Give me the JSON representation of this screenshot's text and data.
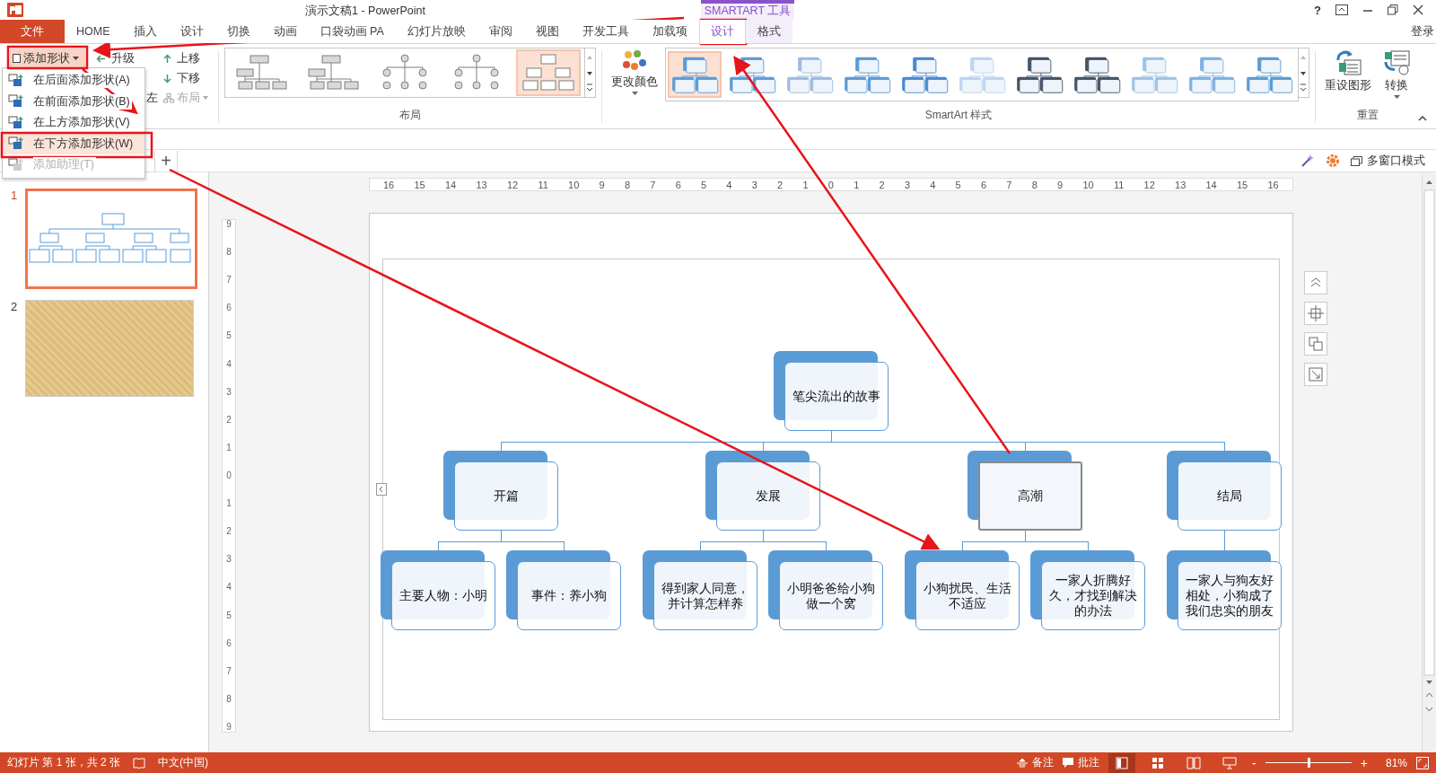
{
  "window": {
    "title": "演示文稿1 - PowerPoint",
    "context_header": "SMARTART 工具",
    "help": "?",
    "sign_in": "登录"
  },
  "tabs": [
    {
      "label": "文件",
      "kind": "file",
      "selected": false
    },
    {
      "label": "HOME",
      "kind": "normal",
      "selected": false
    },
    {
      "label": "插入",
      "kind": "normal",
      "selected": false
    },
    {
      "label": "设计",
      "kind": "normal",
      "selected": false
    },
    {
      "label": "切换",
      "kind": "normal",
      "selected": false
    },
    {
      "label": "动画",
      "kind": "normal",
      "selected": false
    },
    {
      "label": "口袋动画 PA",
      "kind": "normal",
      "selected": false
    },
    {
      "label": "幻灯片放映",
      "kind": "normal",
      "selected": false
    },
    {
      "label": "审阅",
      "kind": "normal",
      "selected": false
    },
    {
      "label": "视图",
      "kind": "normal",
      "selected": false
    },
    {
      "label": "开发工具",
      "kind": "normal",
      "selected": false
    },
    {
      "label": "加载项",
      "kind": "normal",
      "selected": false
    },
    {
      "label": "设计",
      "kind": "context",
      "selected": true
    },
    {
      "label": "格式",
      "kind": "context",
      "selected": false
    }
  ],
  "ribbon": {
    "create": {
      "add_shape": "添加形状",
      "promote": "升级",
      "move_up": "上移",
      "move_down": "下移",
      "right_to_left": "左",
      "layout": "布局"
    },
    "layouts": {
      "label": "布局",
      "items": [
        {
          "selected": false
        },
        {
          "selected": false
        },
        {
          "selected": false
        },
        {
          "selected": false
        },
        {
          "selected": true
        }
      ]
    },
    "change_colors": "更改颜色",
    "styles": {
      "label": "SmartArt 样式",
      "items": [
        {
          "selected": true
        },
        {
          "selected": false
        },
        {
          "selected": false
        },
        {
          "selected": false
        },
        {
          "selected": false
        },
        {
          "selected": false
        },
        {
          "selected": false
        },
        {
          "selected": false
        },
        {
          "selected": false
        },
        {
          "selected": false
        },
        {
          "selected": false
        }
      ]
    },
    "reset": {
      "label": "重置",
      "reset_graphic": "重设图形",
      "convert": "转换"
    }
  },
  "add_shape_menu": [
    {
      "label": "在后面添加形状(A)",
      "selected": false,
      "disabled": false
    },
    {
      "label": "在前面添加形状(B)",
      "selected": false,
      "disabled": false
    },
    {
      "label": "在上方添加形状(V)",
      "selected": false,
      "disabled": false
    },
    {
      "label": "在下方添加形状(W)",
      "selected": true,
      "disabled": false
    },
    {
      "label": "添加助理(T)",
      "selected": false,
      "disabled": true
    }
  ],
  "doc_bar": {
    "new_tab": "+",
    "multi_window": "多窗口模式"
  },
  "slides": [
    {
      "number": "1",
      "selected": true,
      "kind": "org-chart"
    },
    {
      "number": "2",
      "selected": false,
      "kind": "texture"
    }
  ],
  "ruler": {
    "horizontal": [
      "16",
      "15",
      "14",
      "13",
      "12",
      "11",
      "10",
      "9",
      "8",
      "7",
      "6",
      "5",
      "4",
      "3",
      "2",
      "1",
      "0",
      "1",
      "2",
      "3",
      "4",
      "5",
      "6",
      "7",
      "8",
      "9",
      "10",
      "11",
      "12",
      "13",
      "14",
      "15",
      "16"
    ],
    "vertical": [
      "9",
      "8",
      "7",
      "6",
      "5",
      "4",
      "3",
      "2",
      "1",
      "0",
      "1",
      "2",
      "3",
      "4",
      "5",
      "6",
      "7",
      "8",
      "9"
    ]
  },
  "smartart": {
    "root": "笔尖流出的故事",
    "children": [
      {
        "text": "开篇",
        "selected": false,
        "children": [
          {
            "text": "主要人物：小明",
            "selected": false
          },
          {
            "text": "事件：养小狗",
            "selected": false
          }
        ]
      },
      {
        "text": "发展",
        "selected": false,
        "children": [
          {
            "text": "得到家人同意，并计算怎样养",
            "selected": false
          },
          {
            "text": "小明爸爸给小狗做一个窝",
            "selected": false
          }
        ]
      },
      {
        "text": "高潮",
        "selected": true,
        "children": [
          {
            "text": "小狗扰民、生活不适应",
            "selected": false
          },
          {
            "text": "一家人折腾好久，才找到解决的办法",
            "selected": false
          }
        ]
      },
      {
        "text": "结局",
        "selected": false,
        "children": [
          {
            "text": "一家人与狗友好相处，小狗成了我们忠实的朋友",
            "selected": false
          }
        ]
      }
    ]
  },
  "status_bar": {
    "slide_info": "幻灯片 第 1 张，共 2 张",
    "language": "中文(中国)",
    "notes": "备注",
    "comments": "批注",
    "zoom": "81%",
    "zoom_out": "-",
    "zoom_in": "+",
    "zoom_slider": {
      "level": 0.5
    }
  }
}
